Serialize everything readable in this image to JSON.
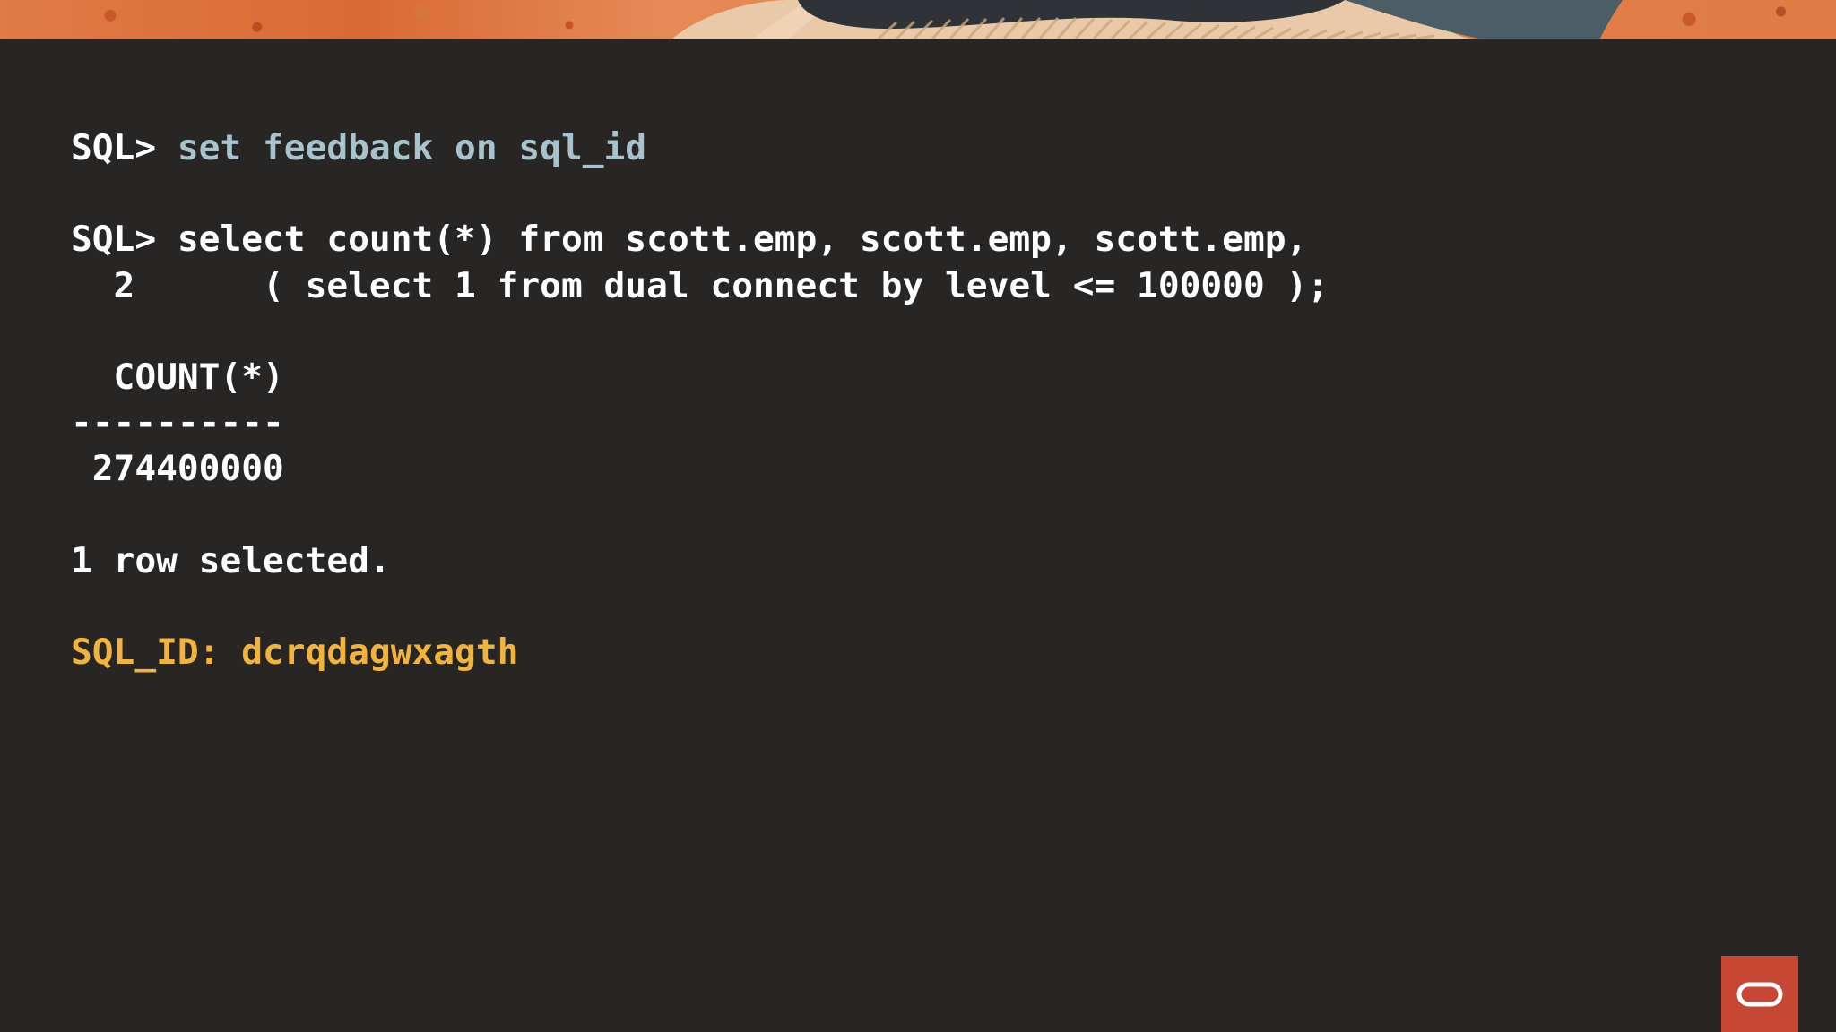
{
  "terminal": {
    "line1": {
      "prompt": "SQL> ",
      "command": "set feedback on sql_id"
    },
    "line2": {
      "prompt": "SQL> ",
      "command": "select count(*) from scott.emp, scott.emp, scott.emp,"
    },
    "line3": "  2      ( select 1 from dual connect by level <= 100000 );",
    "column_header": "  COUNT(*)",
    "separator": "----------",
    "value": " 274400000",
    "status": "1 row selected.",
    "sql_id": "SQL_ID: dcrqdagwxagth"
  },
  "colors": {
    "background": "#282525",
    "command_highlight": "#a8c3cc",
    "sql_id": "#f0b43c",
    "brand": "#c74634"
  },
  "icons": {
    "banner": "decorative-art-banner",
    "logo": "oracle-logo-icon"
  }
}
